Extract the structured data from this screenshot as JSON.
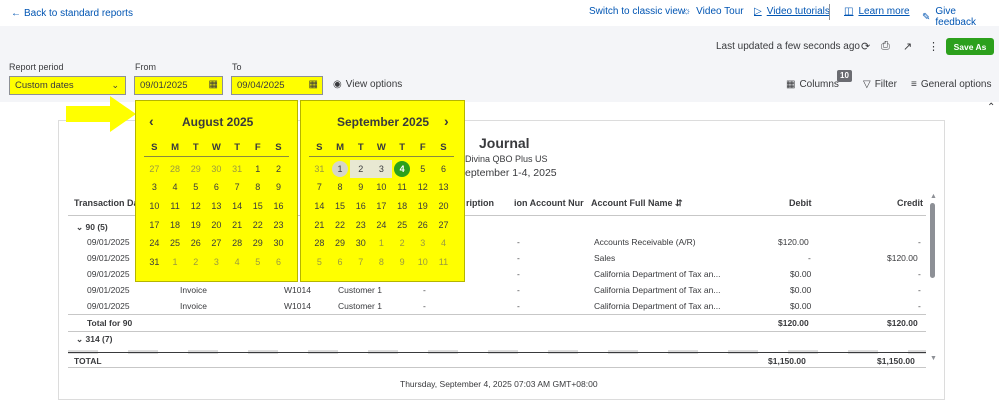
{
  "topbar": {
    "back": "Back to standard reports",
    "classic": "Switch to classic view",
    "video_tour": "Video Tour",
    "video_tutorials": "Video tutorials",
    "learn_more": "Learn more",
    "feedback": "Give feedback"
  },
  "toolbar": {
    "last_updated": "Last updated a few seconds ago",
    "save_as": "Save As",
    "report_period_label": "Report period",
    "report_period_value": "Custom dates",
    "from_label": "From",
    "from_value": "09/01/2025",
    "to_label": "To",
    "to_value": "09/04/2025",
    "view_options": "View options",
    "columns": "Columns",
    "columns_count": "10",
    "filter": "Filter",
    "general_options": "General options"
  },
  "report": {
    "title": "Journal",
    "company": "Divina QBO Plus US",
    "period": "September 1-4, 2025",
    "footer": "Thursday, September 4, 2025 07:03 AM GMT+08:00",
    "columns": [
      "Transaction Dat",
      "ription",
      "ion Account Nur",
      "Account Full Name",
      "Debit",
      "Credit"
    ],
    "group1": "90 (5)",
    "rows": [
      {
        "date": "09/01/2025",
        "type": "",
        "num": "",
        "name": "",
        "memo": "",
        "acct_no": "-",
        "account": "Accounts Receivable (A/R)",
        "debit": "$120.00",
        "credit": "-"
      },
      {
        "date": "09/01/2025",
        "type": "",
        "num": "",
        "name": "",
        "memo": "",
        "acct_no": "-",
        "account": "Sales",
        "debit": "-",
        "credit": "$120.00"
      },
      {
        "date": "09/01/2025",
        "type": "",
        "num": "",
        "name": "",
        "memo": "",
        "acct_no": "-",
        "account": "California Department of Tax an...",
        "debit": "$0.00",
        "credit": "-"
      },
      {
        "date": "09/01/2025",
        "type": "Invoice",
        "num": "W1014",
        "name": "Customer 1",
        "memo": "-",
        "acct_no": "-",
        "account": "California Department of Tax an...",
        "debit": "$0.00",
        "credit": "-"
      },
      {
        "date": "09/01/2025",
        "type": "Invoice",
        "num": "W1014",
        "name": "Customer 1",
        "memo": "-",
        "acct_no": "-",
        "account": "California Department of Tax an...",
        "debit": "$0.00",
        "credit": "-"
      }
    ],
    "total1_label": "Total for 90",
    "total1_debit": "$120.00",
    "total1_credit": "$120.00",
    "group2": "314 (7)",
    "total_label": "TOTAL",
    "total_debit": "$1,150.00",
    "total_credit": "$1,150.00"
  },
  "calendar": {
    "dow": [
      "S",
      "M",
      "T",
      "W",
      "T",
      "F",
      "S"
    ],
    "left": {
      "title": "August 2025",
      "weeks": [
        [
          "27",
          "28",
          "29",
          "30",
          "31",
          "1",
          "2"
        ],
        [
          "3",
          "4",
          "5",
          "6",
          "7",
          "8",
          "9"
        ],
        [
          "10",
          "11",
          "12",
          "13",
          "14",
          "15",
          "16"
        ],
        [
          "17",
          "18",
          "19",
          "20",
          "21",
          "22",
          "23"
        ],
        [
          "24",
          "25",
          "26",
          "27",
          "28",
          "29",
          "30"
        ],
        [
          "31",
          "1",
          "2",
          "3",
          "4",
          "5",
          "6"
        ]
      ]
    },
    "right": {
      "title": "September 2025",
      "weeks": [
        [
          "31",
          "1",
          "2",
          "3",
          "4",
          "5",
          "6"
        ],
        [
          "7",
          "8",
          "9",
          "10",
          "11",
          "12",
          "13"
        ],
        [
          "14",
          "15",
          "16",
          "17",
          "18",
          "19",
          "20"
        ],
        [
          "21",
          "22",
          "23",
          "24",
          "25",
          "26",
          "27"
        ],
        [
          "28",
          "29",
          "30",
          "1",
          "2",
          "3",
          "4"
        ],
        [
          "5",
          "6",
          "7",
          "8",
          "9",
          "10",
          "11"
        ]
      ]
    }
  },
  "colors": {
    "accent": "#2ca01c",
    "highlight": "#ffff00",
    "link": "#0055b3"
  }
}
